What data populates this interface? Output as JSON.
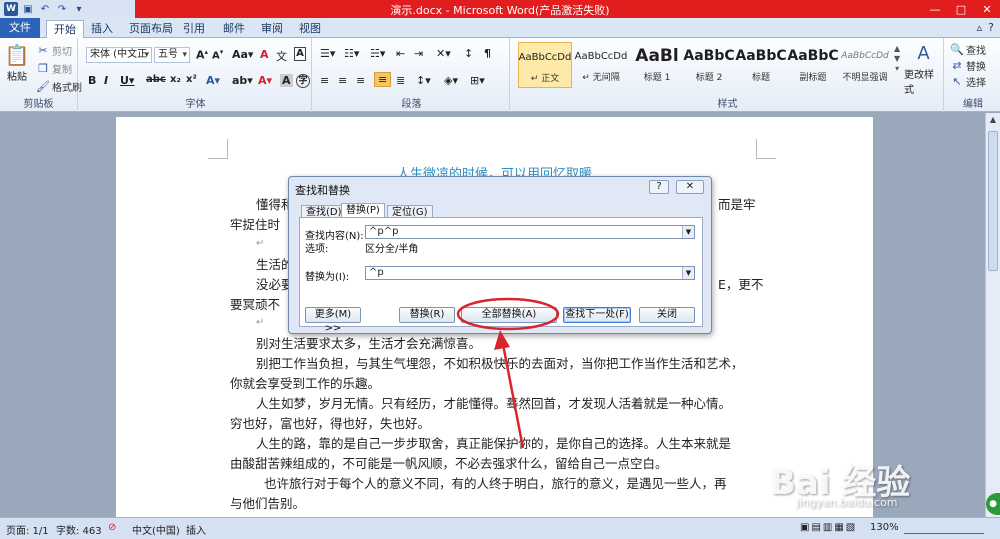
{
  "window": {
    "title": "演示.docx - Microsoft Word(产品激活失败)",
    "controls": [
      "—",
      "□",
      "✕"
    ]
  },
  "ribbon_tabs": [
    "文件",
    "开始",
    "插入",
    "页面布局",
    "引用",
    "邮件",
    "审阅",
    "视图"
  ],
  "clipboard": {
    "paste": "粘贴",
    "cut": "剪切",
    "copy": "复制",
    "format_painter": "格式刷",
    "label": "剪贴板"
  },
  "font": {
    "name": "宋体 (中文正",
    "size": "五号",
    "label": "字体"
  },
  "paragraph": {
    "label": "段落"
  },
  "styles": {
    "items": [
      {
        "sample": "AaBbCcDd",
        "name": "↵ 正文"
      },
      {
        "sample": "AaBbCcDd",
        "name": "↵ 无间隔"
      },
      {
        "sample": "AaBl",
        "name": "标题 1"
      },
      {
        "sample": "AaBbC",
        "name": "标题 2"
      },
      {
        "sample": "AaBbC",
        "name": "标题"
      },
      {
        "sample": "AaBbC",
        "name": "副标题"
      },
      {
        "sample": "AaBbCcDd",
        "name": "不明显强调"
      }
    ],
    "change_styles": "更改样式",
    "label": "样式"
  },
  "editing": {
    "find": "查找",
    "replace": "替换",
    "select": "选择",
    "label": "编辑"
  },
  "document": {
    "title": "人生微凉的时候，可以用回忆取暖",
    "lines": [
      "懂得和",
      "而是牢",
      "牢捉住时",
      "生活的",
      "没必要",
      "E，更不",
      "要冥顽不",
      "别对生活要求太多，生活才会充满惊喜。",
      "别把工作当负担，与其生气埋怨，不如积极快乐的去面对，当你把工作当作生活和艺术，",
      "你就会享受到工作的乐趣。",
      "人生如梦，岁月无情。只有经历，才能懂得。蓦然回首，才发现人活着就是一种心情。",
      "穷也好，富也好，得也好，失也好。",
      "人生的路，靠的是自己一步步取舍，真正能保护你的，是你自己的选择。人生本来就是",
      "由酸甜苦辣组成的，不可能是一帆风顺，不必去强求什么，留给自己一点空白。",
      "也许旅行对于每个人的意义不同，有的人终于明白，旅行的意义，是遇见一些人，再",
      "与他们告别。"
    ],
    "return_mark": "↵"
  },
  "dialog": {
    "title": "查找和替换",
    "help": "?",
    "close": "✕",
    "tabs": [
      "查找(D)",
      "替换(P)",
      "定位(G)"
    ],
    "find_label": "查找内容(N):",
    "find_value": "^p^p",
    "options_label": "选项:",
    "options_value": "区分全/半角",
    "replace_label": "替换为(I):",
    "replace_value": "^p",
    "buttons": {
      "more": "更多(M) >>",
      "replace": "替换(R)",
      "replace_all": "全部替换(A)",
      "find_next": "查找下一处(F)",
      "close": "关闭"
    }
  },
  "statusbar": {
    "page": "页面: 1/1",
    "words": "字数: 463",
    "language": "中文(中国)",
    "mode": "插入",
    "zoom": "130%"
  },
  "watermark": {
    "text": "Bai 经验",
    "sub": "jingyan.baidu.com"
  },
  "colors": {
    "titlebar": "#e21d1d",
    "file_tab": "#2b63b8",
    "doc_title": "#2f8fbf",
    "annotation": "#d9262c"
  }
}
